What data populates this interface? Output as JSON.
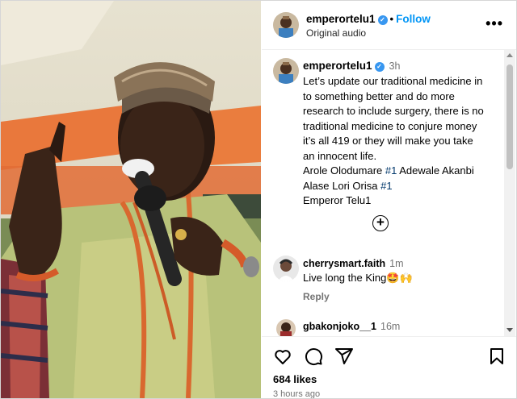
{
  "post": {
    "author": "emperortelu1",
    "verified": true,
    "separator": "•",
    "follow_label": "Follow",
    "audio": "Original audio",
    "more_label": "•••"
  },
  "caption": {
    "author": "emperortelu1",
    "time": "3h",
    "lines": [
      "Let’s update our traditional medicine in",
      "to something better and do more",
      "research to include surgery, there is no",
      "traditional medicine to conjure money",
      "it’s all 419 or they will make you take",
      "an innocent life."
    ],
    "line7_text": "Arole Olodumare ",
    "line7_tag": "#1",
    "line7_rest": " Adewale Akanbi",
    "line8_text": "Alase Lori Orisa ",
    "line8_tag": "#1",
    "line9": "Emperor Telu1",
    "load_more_label": "+"
  },
  "comments": [
    {
      "author": "cherrysmart.faith",
      "time": "1m",
      "text": "Live long the King🤩🙌",
      "reply_label": "Reply"
    },
    {
      "author": "gbakonjoko__1",
      "time": "16m"
    }
  ],
  "engagement": {
    "likes": "684 likes",
    "posted": "3 hours ago"
  },
  "icons": [
    "heart-icon",
    "comment-icon",
    "share-icon",
    "bookmark-icon",
    "add-circle-icon",
    "verified-icon",
    "more-icon"
  ],
  "colors": {
    "follow": "#0095f6",
    "verified": "#3897f0",
    "muted": "#737373",
    "hashtag": "#00376b"
  }
}
